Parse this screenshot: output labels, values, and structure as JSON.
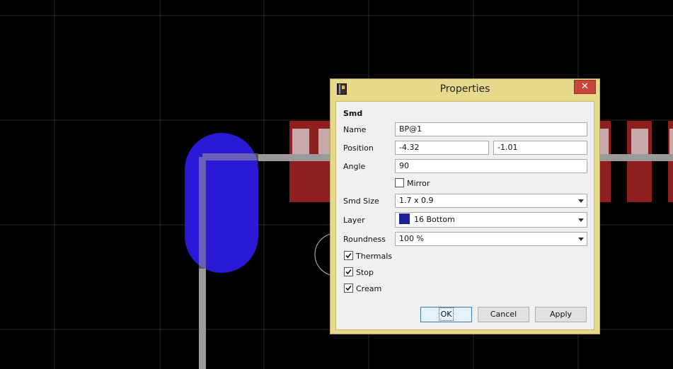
{
  "dialog": {
    "title": "Properties",
    "close_label": "✕",
    "section": "Smd",
    "name": {
      "label": "Name",
      "value": "BP@1"
    },
    "position": {
      "label": "Position",
      "x": "-4.32",
      "y": "-1.01"
    },
    "angle": {
      "label": "Angle",
      "value": "90"
    },
    "mirror": {
      "label": "Mirror",
      "checked": false
    },
    "smd_size": {
      "label": "Smd Size",
      "value": "1.7 x 0.9"
    },
    "layer": {
      "label": "Layer",
      "value": "16 Bottom",
      "color": "#1f1f99"
    },
    "roundness": {
      "label": "Roundness",
      "value": "100 %"
    },
    "thermals": {
      "label": "Thermals",
      "checked": true
    },
    "stop": {
      "label": "Stop",
      "checked": true
    },
    "cream": {
      "label": "Cream",
      "checked": true
    },
    "buttons": {
      "ok": "OK",
      "cancel": "Cancel",
      "apply": "Apply"
    }
  },
  "colors": {
    "background": "#000000",
    "grid": "#2a2a2a",
    "pad_bottom": "#2a1ad6",
    "pad_top": "#8f1f1f",
    "trace": "#9a9a9a",
    "dialog_frame": "#e7d98b"
  }
}
